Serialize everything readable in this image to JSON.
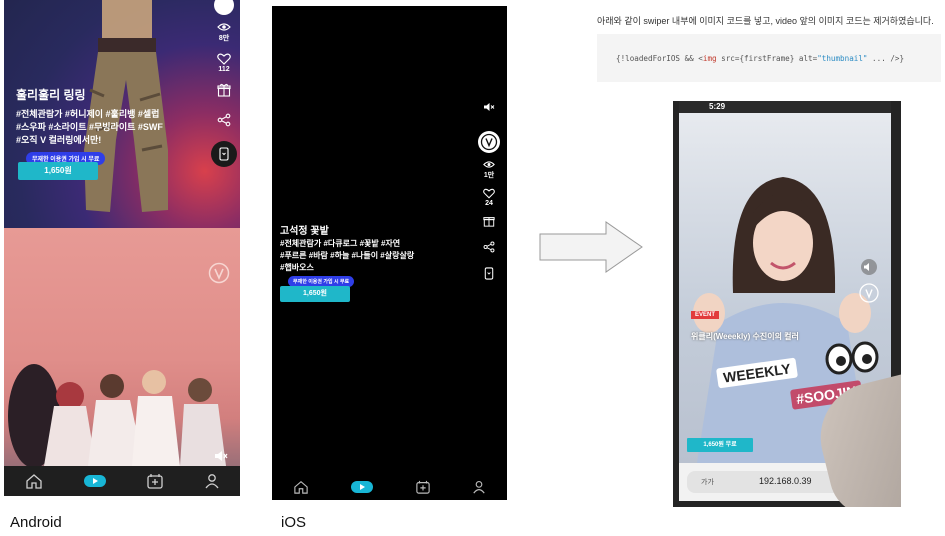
{
  "android": {
    "caption": "Android",
    "title": "훌리훌리 링링",
    "tags": [
      "#전체관람가 #허니제이 #훌리뱅 #셀럽",
      "#스우파 #소라이트 #무빙라이트 #SWF",
      "#오직 V 컬러링에서만!"
    ],
    "badge": "무재한 이용권 가입 시 무료",
    "price": "1,650원",
    "views": "8만",
    "likes": "112"
  },
  "ios": {
    "caption": "iOS",
    "title": "고석정 꽃밭",
    "tags": [
      "#전체관람가 #다큐로그 #꽃밭 #자연",
      "#푸르른 #바람 #하늘 #나들이 #살랑살랑",
      "#햅바오스"
    ],
    "badge": "무재한 이용권 가입 시 무료",
    "price": "1,650원",
    "views": "1만",
    "likes": "24"
  },
  "note": {
    "text": "아래와 같이 swiper 내부에 이미지 코드를 넣고, video 앞의 이미지 코드는 제거하였습니다.",
    "code_open": "{!loadedForIOS && <",
    "code_tag": "img",
    "code_src": " src={firstFrame} alt=",
    "code_alt": "\"thumbnail\"",
    "code_close": " ... />}"
  },
  "photo": {
    "time": "5:29",
    "event": "EVENT",
    "title": "위클리(Weeekly) 수진이의 컬러",
    "sticker1": "WEEEKLY",
    "sticker2": "#SOOJIN",
    "price": "1,650원 무료",
    "url_aa": "가가",
    "url": "192.168.0.39"
  },
  "colors": {
    "accent_cyan": "#1fb7c9",
    "badge_blue": "#2f3ee8",
    "event_red": "#e23b3b"
  }
}
